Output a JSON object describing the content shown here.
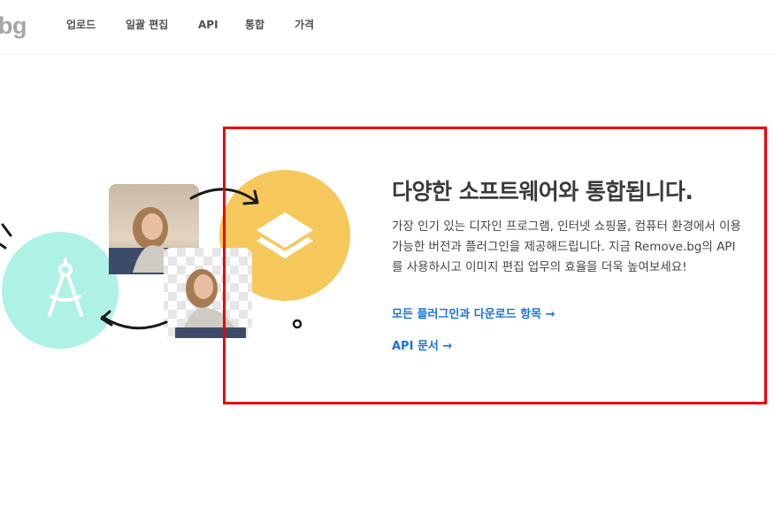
{
  "nav": {
    "logo_text": "bg",
    "links": [
      "업로드",
      "일괄 편집",
      "API",
      "통합",
      "가격"
    ]
  },
  "integrations": {
    "title": "다양한 소프트웨어와 통합됩니다.",
    "description_lines": [
      "가장 인기 있는 디자인 프로그램, 인터넷 쇼핑몰, 컴퓨터 환경에서 이용",
      "가능한 버전과 플러그인을 제공해드립니다. 지금 Remove.bg의 API",
      "를 사용하시고 이미지 편집 업무의 효율을 더욱 높여보세요!"
    ],
    "link_plugins": "모든 플러그인과 다운로드 항목 →",
    "link_api_docs": "API 문서 →"
  },
  "colors": {
    "accent_link": "#1a73d9",
    "circle_teal": "#aef2e6",
    "circle_yellow": "#f6c85c",
    "highlight_border": "#ee0000"
  },
  "icons": {
    "design_tool": "compass-icon",
    "layers": "layers-icon"
  }
}
